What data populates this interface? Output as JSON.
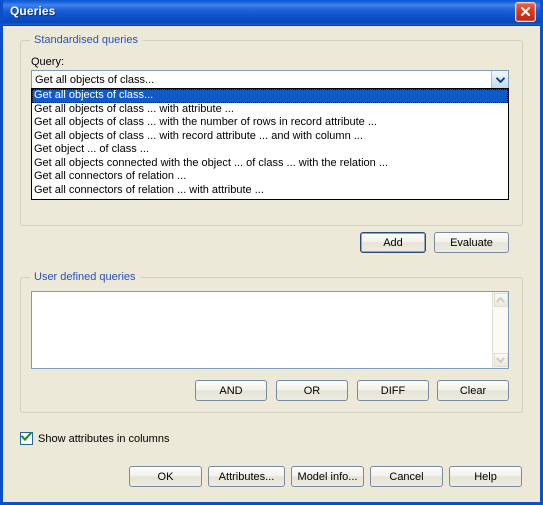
{
  "window": {
    "title": "Queries",
    "close_label": "Close",
    "accent_titlebar": "#0a50c8",
    "accent_close": "#d83a1c",
    "dialog_face": "#ece9d8",
    "legend_color": "#2b51b5",
    "selection_color": "#1059c8"
  },
  "standardised": {
    "legend": "Standardised queries",
    "query_label": "Query:",
    "combo_value": "Get all objects of class...",
    "options": [
      "Get all objects of class...",
      "Get all objects of class ... with attribute ...",
      "Get all objects of class ... with the number of rows in record attribute ...",
      "Get all objects of class ... with record attribute ... and with column ...",
      "Get object ... of class ...",
      "Get all objects connected with the object ... of class ... with the relation ...",
      "Get all connectors of relation ...",
      "Get all connectors of relation ... with attribute ..."
    ],
    "selected_index": 0,
    "add_label": "Add",
    "evaluate_label": "Evaluate"
  },
  "user_defined": {
    "legend": "User defined queries",
    "textarea_value": "",
    "and_label": "AND",
    "or_label": "OR",
    "diff_label": "DIFF",
    "clear_label": "Clear"
  },
  "options_row": {
    "show_attributes_label": "Show attributes in columns",
    "show_attributes_checked": true
  },
  "footer": {
    "ok_label": "OK",
    "attributes_label": "Attributes...",
    "model_info_label": "Model info...",
    "cancel_label": "Cancel",
    "help_label": "Help"
  }
}
